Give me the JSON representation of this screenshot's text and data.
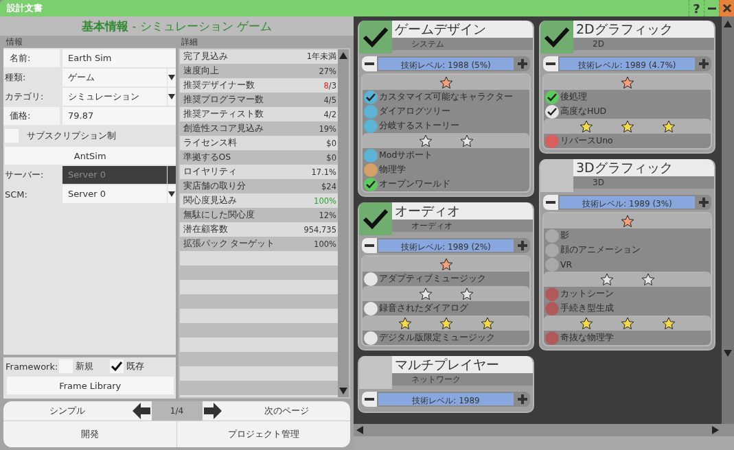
{
  "window": {
    "title": "設計文書",
    "help_button": "?"
  },
  "header": {
    "title": "**基本情報** - シミュレーション ゲーム"
  },
  "info": {
    "heading": "情報",
    "fields": [
      {
        "kind": "text",
        "label": "名前:",
        "value": "Earth Sim"
      },
      {
        "kind": "select",
        "label": "種類:",
        "value": "ゲーム"
      },
      {
        "kind": "select",
        "label": "カテゴリ:",
        "value": "シミュレーション"
      },
      {
        "kind": "text",
        "label": "価格:",
        "value": "79.87"
      }
    ],
    "subscription": {
      "label": "サブスクリプション制",
      "checked": false
    },
    "engine_button": "AntSim",
    "server_fields": [
      {
        "label": "サーバー:",
        "value": "Server 0",
        "disabled": true
      },
      {
        "label": "SCM:",
        "value": "Server 0",
        "disabled": false
      }
    ],
    "framework": {
      "label": "Framework:",
      "options": [
        {
          "label": "新規",
          "selected": false
        },
        {
          "label": "既存",
          "selected": true
        }
      ],
      "button": "Frame Library"
    }
  },
  "details": {
    "heading": "詳細",
    "rows": [
      {
        "label": "完了見込み",
        "value": [
          {
            "text": "1年未満",
            "color": "#333333"
          }
        ]
      },
      {
        "label": "速度向上",
        "value": [
          {
            "text": "27%",
            "color": "#333333"
          }
        ]
      },
      {
        "label": "推奨デザイナー数",
        "value": [
          {
            "text": "8",
            "color": "#e02020"
          },
          {
            "text": "/3",
            "color": "#333333"
          }
        ]
      },
      {
        "label": "推奨プログラマー数",
        "value": [
          {
            "text": "4/5",
            "color": "#333333"
          }
        ]
      },
      {
        "label": "推奨アーティスト数",
        "value": [
          {
            "text": "4/2",
            "color": "#333333"
          }
        ]
      },
      {
        "label": "創造性スコア見込み",
        "value": [
          {
            "text": "19%",
            "color": "#333333"
          }
        ]
      },
      {
        "label": "ライセンス料",
        "value": [
          {
            "text": "$0",
            "color": "#333333"
          }
        ]
      },
      {
        "label": "準拠するOS",
        "value": [
          {
            "text": "$0",
            "color": "#333333"
          }
        ]
      },
      {
        "label": "ロイヤリティ",
        "value": [
          {
            "text": "17.1%",
            "color": "#333333"
          }
        ]
      },
      {
        "label": "実店舗の取り分",
        "value": [
          {
            "text": "$24",
            "color": "#333333"
          }
        ]
      },
      {
        "label": "関心度見込み",
        "value": [
          {
            "text": "100%",
            "color": "#2fa02f"
          }
        ]
      },
      {
        "label": "無駄にした関心度",
        "value": [
          {
            "text": "12%",
            "color": "#333333"
          }
        ]
      },
      {
        "label": "潜在顧客数",
        "value": [
          {
            "text": "954,735",
            "color": "#333333"
          }
        ]
      },
      {
        "label": "拡張パック ターゲット",
        "value": [
          {
            "text": "100%",
            "color": "#333333"
          }
        ]
      }
    ]
  },
  "nav": {
    "prev": "シンプル",
    "page": "1/4",
    "next": "次のページ",
    "actions": [
      "開発",
      "プロジェクト管理"
    ]
  },
  "card_columns": [
    {
      "cards": [
        {
          "title": "ゲームデザイン",
          "subtitle": "システム",
          "selected": true,
          "tech_level": "技術レベル: 1988 (5%)",
          "tiers": [
            {
              "kind": "bronze",
              "features": [
                {
                  "label": "カスタマイズ可能なキャラクター",
                  "color": "#5bb4d6",
                  "checked": true
                },
                {
                  "label": "ダイアログツリー",
                  "color": "#5bb4d6",
                  "checked": false
                },
                {
                  "label": "分岐するストーリー",
                  "color": "#5bb4d6",
                  "checked": false
                }
              ]
            },
            {
              "kind": "silver",
              "features": [
                {
                  "label": "Modサポート",
                  "color": "#5bb4d6",
                  "checked": false
                },
                {
                  "label": "物理学",
                  "color": "#d4a066",
                  "checked": false
                },
                {
                  "label": "オープンワールド",
                  "color": "#5ecb5e",
                  "checked": true
                }
              ]
            }
          ]
        },
        {
          "title": "オーディオ",
          "subtitle": "オーディオ",
          "selected": true,
          "tech_level": "技術レベル: 1989 (2%)",
          "tiers": [
            {
              "kind": "bronze",
              "features": [
                {
                  "label": "アダプティブミュージック",
                  "color": "#e6e6e6",
                  "checked": false
                }
              ]
            },
            {
              "kind": "silver",
              "features": [
                {
                  "label": "録音されたダイアログ",
                  "color": "#e6e6e6",
                  "checked": false
                }
              ]
            },
            {
              "kind": "gold",
              "features": [
                {
                  "label": "デジタル版限定ミュージック",
                  "color": "#e6e6e6",
                  "checked": false
                }
              ]
            }
          ]
        },
        {
          "title": "マルチプレイヤー",
          "subtitle": "ネットワーク",
          "selected": false,
          "tech_level": "技術レベル: 1989"
        }
      ]
    },
    {
      "cards": [
        {
          "title": "2Dグラフィック",
          "subtitle": "2D",
          "selected": true,
          "tech_level": "技術レベル: 1989 (4.7%)",
          "tiers": [
            {
              "kind": "bronze",
              "features": [
                {
                  "label": "後処理",
                  "color": "#5ecb5e",
                  "checked": true
                },
                {
                  "label": "高度なHUD",
                  "color": "#e6e6e6",
                  "checked": true
                }
              ]
            },
            {
              "kind": "gold",
              "features": [
                {
                  "label": "リバースUno",
                  "color": "#d95f5f",
                  "checked": false
                }
              ]
            }
          ]
        },
        {
          "title": "3Dグラフィック",
          "subtitle": "3D",
          "selected": false,
          "tech_level": "技術レベル: 1989 (3%)",
          "tiers": [
            {
              "kind": "bronze",
              "features": [
                {
                  "label": "影",
                  "color": "#a9a9a9",
                  "checked": false
                },
                {
                  "label": "顔のアニメーション",
                  "color": "#a9a9a9",
                  "checked": false
                },
                {
                  "label": "VR",
                  "color": "#a9a9a9",
                  "checked": false
                }
              ]
            },
            {
              "kind": "silver",
              "features": [
                {
                  "label": "カットシーン",
                  "color": "#b05a5a",
                  "checked": false
                },
                {
                  "label": "手続き型生成",
                  "color": "#b05a5a",
                  "checked": false
                }
              ]
            },
            {
              "kind": "gold",
              "features": [
                {
                  "label": "奇抜な物理学",
                  "color": "#b05a5a",
                  "checked": false
                }
              ]
            }
          ]
        }
      ]
    }
  ]
}
